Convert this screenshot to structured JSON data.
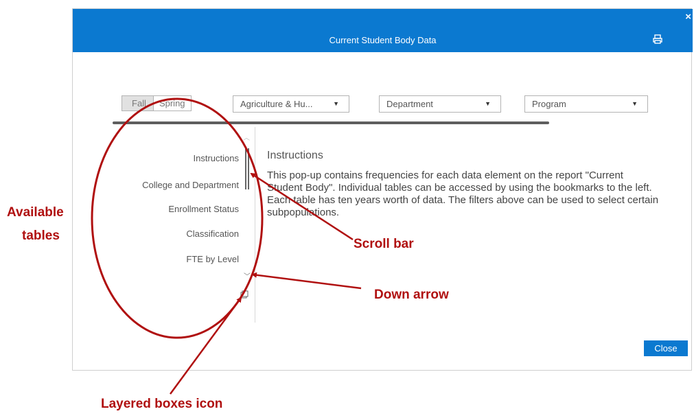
{
  "dialog": {
    "title": "Current Student Body Data",
    "close_label": "Close"
  },
  "filters": {
    "term_fall": "Fall",
    "term_spring": "Spring",
    "college": "Agriculture & Hu...",
    "department": "Department",
    "program": "Program"
  },
  "sidebar": {
    "items": [
      "Instructions",
      "College and Department",
      "Enrollment Status",
      "Classification",
      "FTE by Level"
    ]
  },
  "content": {
    "title": "Instructions",
    "body": "This pop-up contains frequencies for each data element on the report \"Current Student Body\".  Individual tables can be accessed by using the bookmarks to the left. Each table has ten years worth of data. The filters above can be used to select certain subpopulations."
  },
  "annotations": {
    "available_tables_1": "Available",
    "available_tables_2": "tables",
    "scroll_bar": "Scroll bar",
    "down_arrow": "Down arrow",
    "layered_boxes": "Layered boxes icon",
    "color": "#b01010"
  },
  "icons": {
    "close": "close-icon",
    "print": "print-icon",
    "up": "chevron-up-icon",
    "down": "chevron-down-icon",
    "layers": "layered-boxes-icon"
  }
}
